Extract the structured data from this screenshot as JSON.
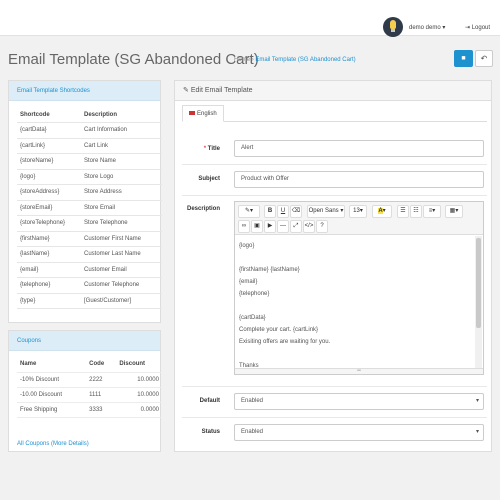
{
  "header": {
    "user": "demo demo",
    "logout": "Logout"
  },
  "page": {
    "title": "Email Template (SG Abandoned Cart)",
    "breadcrumb_home": "Home",
    "breadcrumb_current": "Email Template (SG Abandoned Cart)"
  },
  "shortcodes": {
    "title": "Email Template Shortcodes",
    "col_shortcode": "Shortcode",
    "col_description": "Description",
    "rows": [
      {
        "code": "{cartData}",
        "desc": "Cart Information"
      },
      {
        "code": "{cartLink}",
        "desc": "Cart Link"
      },
      {
        "code": "{storeName}",
        "desc": "Store Name"
      },
      {
        "code": "{logo}",
        "desc": "Store Logo"
      },
      {
        "code": "{storeAddress}",
        "desc": "Store Address"
      },
      {
        "code": "{storeEmail}",
        "desc": "Store Email"
      },
      {
        "code": "{storeTelephone}",
        "desc": "Store Telephone"
      },
      {
        "code": "{firstName}",
        "desc": "Customer First Name"
      },
      {
        "code": "{lastName}",
        "desc": "Customer Last Name"
      },
      {
        "code": "{email}",
        "desc": "Customer Email"
      },
      {
        "code": "{telephone}",
        "desc": "Customer Telephone"
      },
      {
        "code": "{type}",
        "desc": "[Guest/Customer]"
      }
    ]
  },
  "coupons": {
    "title": "Coupons",
    "col_name": "Name",
    "col_code": "Code",
    "col_discount": "Discount",
    "rows": [
      {
        "name": "-10% Discount",
        "code": "2222",
        "discount": "10.0000"
      },
      {
        "name": "-10.00 Discount",
        "code": "1111",
        "discount": "10.0000"
      },
      {
        "name": "Free Shipping",
        "code": "3333",
        "discount": "0.0000"
      }
    ],
    "all_link": "All Coupons (More Details)"
  },
  "editor": {
    "title": "Edit Email Template",
    "tab": "English",
    "title_label": "Title",
    "title_value": "Alert",
    "subject_label": "Subject",
    "subject_value": "Product with Offer",
    "description_label": "Description",
    "font_name": "Open Sans",
    "font_size": "13",
    "content_lines": [
      "{logo}",
      "",
      "{firstName} {lastName}",
      "{email}",
      "{telephone}",
      "",
      "{cartData}",
      "Complete your cart. {cartLink}",
      "Exisiting offers are waiting for you.",
      "",
      "Thanks"
    ],
    "default_label": "Default",
    "default_value": "Enabled",
    "status_label": "Status",
    "status_value": "Enabled"
  },
  "colors": {
    "primary": "#1e91cf",
    "panel_head": "#dcedf7",
    "required": "#d9534f"
  }
}
